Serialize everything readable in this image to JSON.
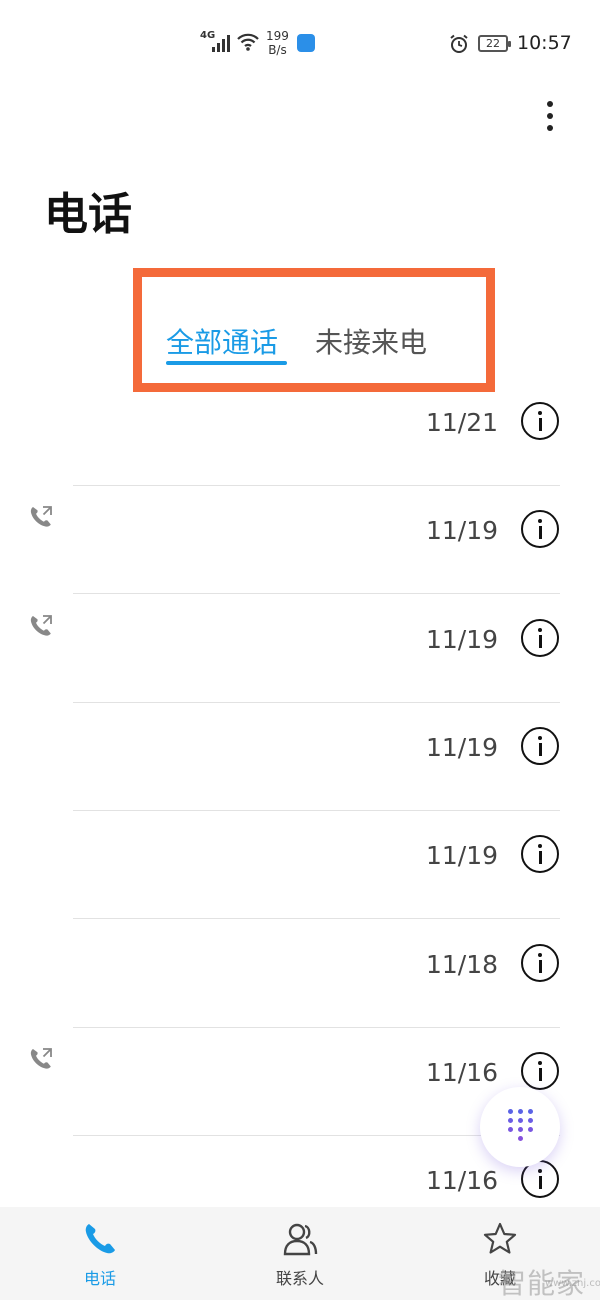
{
  "status_bar": {
    "network": "4G",
    "speed_value": "199",
    "speed_unit": "B/s",
    "battery": "22",
    "time": "10:57"
  },
  "header": {
    "title": "电话",
    "more_icon": "more-vertical-icon"
  },
  "tabs": [
    {
      "label": "全部通话",
      "active": true
    },
    {
      "label": "未接来电",
      "active": false
    }
  ],
  "calls": [
    {
      "date": "11/21",
      "outgoing": false
    },
    {
      "date": "11/19",
      "outgoing": true
    },
    {
      "date": "11/19",
      "outgoing": true
    },
    {
      "date": "11/19",
      "outgoing": false
    },
    {
      "date": "11/19",
      "outgoing": false
    },
    {
      "date": "11/18",
      "outgoing": false
    },
    {
      "date": "11/16",
      "outgoing": true
    },
    {
      "date": "11/16",
      "outgoing": false
    }
  ],
  "bottom_nav": [
    {
      "label": "电话",
      "icon": "phone-icon",
      "active": true
    },
    {
      "label": "联系人",
      "icon": "contacts-icon",
      "active": false
    },
    {
      "label": "收藏",
      "icon": "star-icon",
      "active": false
    }
  ],
  "watermark": {
    "text": "智能家",
    "url": "www.znj.com"
  },
  "colors": {
    "accent": "#1a9be6",
    "highlight_box": "#f46a3a"
  }
}
